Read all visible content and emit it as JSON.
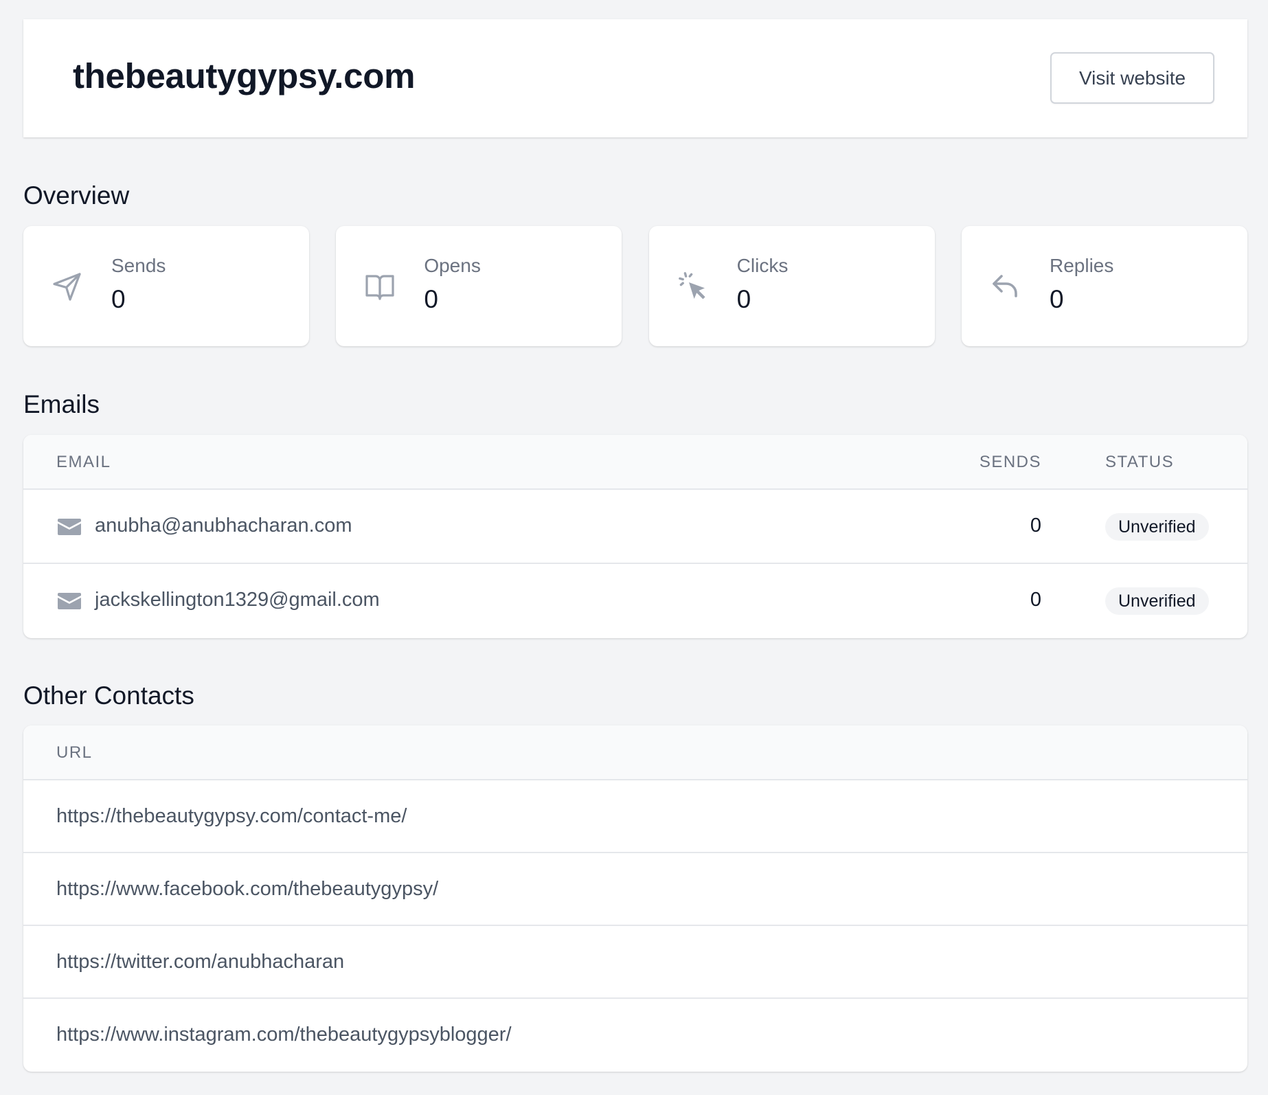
{
  "header": {
    "title": "thebeautygypsy.com",
    "visit_label": "Visit website"
  },
  "overview": {
    "title": "Overview",
    "stats": [
      {
        "label": "Sends",
        "value": "0",
        "icon": "send-icon"
      },
      {
        "label": "Opens",
        "value": "0",
        "icon": "book-open-icon"
      },
      {
        "label": "Clicks",
        "value": "0",
        "icon": "cursor-click-icon"
      },
      {
        "label": "Replies",
        "value": "0",
        "icon": "reply-icon"
      }
    ]
  },
  "emails": {
    "title": "Emails",
    "columns": {
      "email": "EMAIL",
      "sends": "SENDS",
      "status": "STATUS"
    },
    "rows": [
      {
        "email": "anubha@anubhacharan.com",
        "sends": "0",
        "status": "Unverified"
      },
      {
        "email": "jackskellington1329@gmail.com",
        "sends": "0",
        "status": "Unverified"
      }
    ]
  },
  "other_contacts": {
    "title": "Other Contacts",
    "columns": {
      "url": "URL"
    },
    "rows": [
      "https://thebeautygypsy.com/contact-me/",
      "https://www.facebook.com/thebeautygypsy/",
      "https://twitter.com/anubhacharan",
      "https://www.instagram.com/thebeautygypsyblogger/"
    ]
  },
  "colors": {
    "background": "#f3f4f6",
    "card": "#ffffff",
    "icon": "#9ca3af",
    "text_primary": "#111827",
    "text_secondary": "#6b7280"
  }
}
